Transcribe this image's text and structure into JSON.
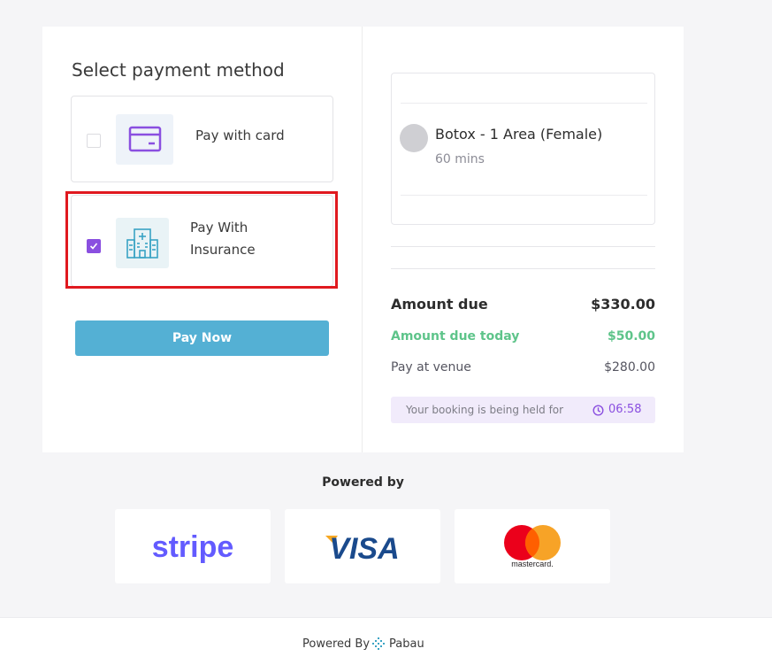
{
  "payment": {
    "title": "Select payment method",
    "options": [
      {
        "label": "Pay with card",
        "icon": "credit-card-icon",
        "selected": false
      },
      {
        "label": "Pay With Insurance",
        "icon": "hospital-building-icon",
        "selected": true
      }
    ],
    "pay_button": "Pay Now"
  },
  "service": {
    "name": "Botox - 1 Area (Female)",
    "duration": "60 mins"
  },
  "summary": {
    "amount_due_label": "Amount due",
    "amount_due_value": "$330.00",
    "due_today_label": "Amount due today",
    "due_today_value": "$50.00",
    "venue_label": "Pay at venue",
    "venue_value": "$280.00"
  },
  "hold": {
    "text": "Your booking is being held for",
    "time": "06:58",
    "icon": "clock-icon"
  },
  "powered": {
    "title": "Powered by",
    "logos": [
      {
        "name": "stripe",
        "text": "stripe"
      },
      {
        "name": "visa",
        "text": "VISA"
      },
      {
        "name": "mastercard",
        "text": "mastercard."
      }
    ]
  },
  "footer": {
    "text": "Powered By",
    "brand": "Pabau"
  },
  "colors": {
    "accent_purple": "#8a4fe0",
    "button_blue": "#54b0d4",
    "due_today_green": "#5ec48a",
    "highlight_red": "#e0191f"
  }
}
